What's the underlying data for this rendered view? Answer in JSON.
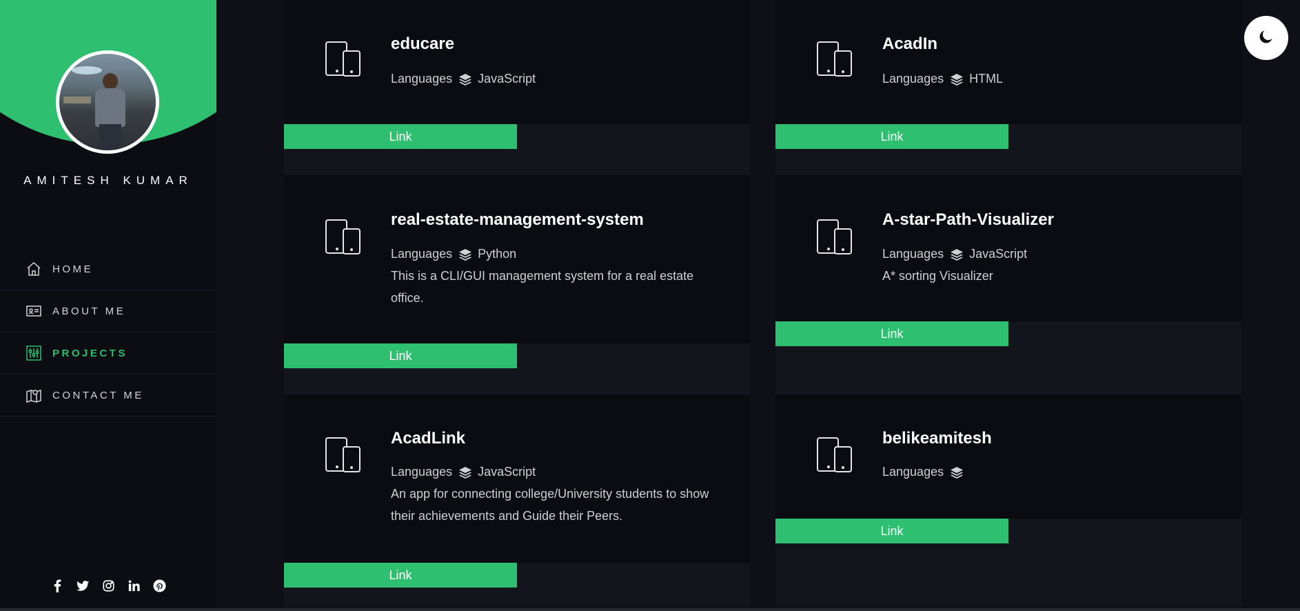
{
  "profile": {
    "name": "AMITESH KUMAR"
  },
  "nav": {
    "items": [
      {
        "label": "HOME",
        "icon": "home-icon"
      },
      {
        "label": "ABOUT ME",
        "icon": "id-card-icon"
      },
      {
        "label": "PROJECTS",
        "icon": "sliders-icon",
        "active": true
      },
      {
        "label": "CONTACT ME",
        "icon": "map-pin-icon"
      }
    ]
  },
  "socials": [
    "facebook-icon",
    "twitter-icon",
    "instagram-icon",
    "linkedin-icon",
    "pinterest-icon"
  ],
  "projects": [
    {
      "title": "educare",
      "languages_label": "Languages",
      "language": "JavaScript",
      "description": "",
      "link": "Link"
    },
    {
      "title": "AcadIn",
      "languages_label": "Languages",
      "language": "HTML",
      "description": "",
      "link": "Link"
    },
    {
      "title": "real-estate-management-system",
      "languages_label": "Languages",
      "language": "Python",
      "description": "This is a CLI/GUI management system for a real estate office.",
      "link": "Link"
    },
    {
      "title": "A-star-Path-Visualizer",
      "languages_label": "Languages",
      "language": "JavaScript",
      "description": "A* sorting Visualizer",
      "link": "Link"
    },
    {
      "title": "AcadLink",
      "languages_label": "Languages",
      "language": "JavaScript",
      "description": "An app for connecting college/University students to show their achievements and Guide their Peers.",
      "link": "Link"
    },
    {
      "title": "belikeamitesh",
      "languages_label": "Languages",
      "language": "",
      "description": "",
      "link": "Link"
    }
  ],
  "colors": {
    "accent": "#2ebf70",
    "background": "#0f1017",
    "card": "#0b0c12"
  },
  "theme_toggle_icon": "moon-icon"
}
